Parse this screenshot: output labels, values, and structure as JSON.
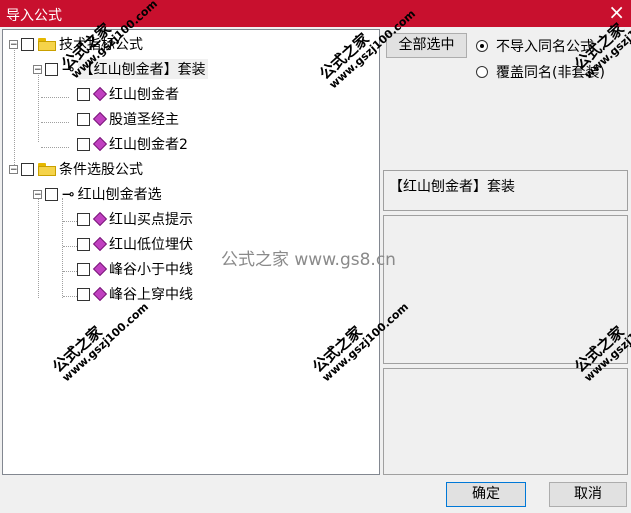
{
  "window": {
    "title": "导入公式",
    "close_label": "×"
  },
  "tree": {
    "group1": "技术指标公式",
    "suite": "【红山刨金者】套装",
    "items1": [
      "红山刨金者",
      "股道圣经主",
      "红山刨金者2"
    ],
    "group2": "条件选股公式",
    "sub": "红山刨金者选",
    "items2": [
      "红山买点提示",
      "红山低位埋伏",
      "峰谷小于中线",
      "峰谷上穿中线"
    ]
  },
  "options": {
    "select_all": "全部选中",
    "radio1": "不导入同名公式",
    "radio2": "覆盖同名(非套装)"
  },
  "info_text": "【红山刨金者】套装",
  "watermark": {
    "center": "公式之家 www.gs8.cn",
    "corner_big": "公式之家",
    "corner_small": "www.gszj100.com"
  },
  "buttons": {
    "ok": "确定",
    "cancel": "取消"
  }
}
